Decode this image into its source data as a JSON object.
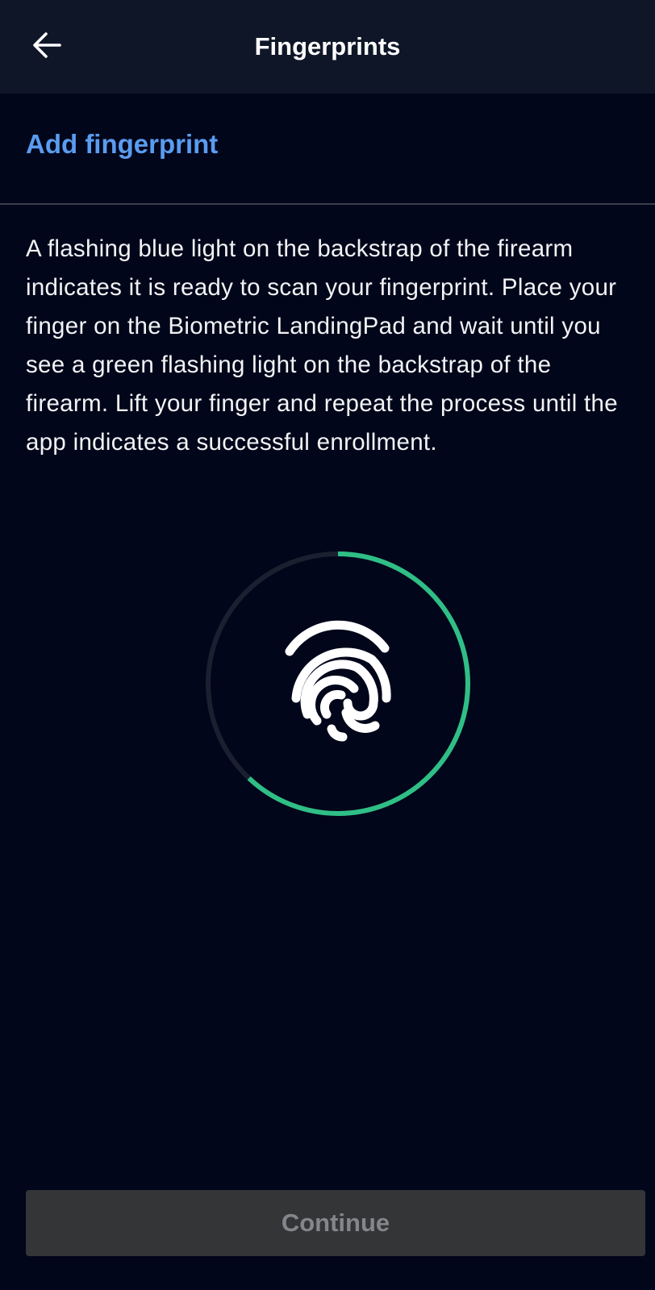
{
  "header": {
    "title": "Fingerprints",
    "back_icon": "arrow-left-icon"
  },
  "section": {
    "title": "Add fingerprint"
  },
  "instructions": {
    "text": "A flashing blue light on the backstrap of the firearm indicates it is ready to scan your fingerprint. Place your finger on the Biometric LandingPad and wait until you see a green flashing light on the backstrap of the firearm. Lift your finger and repeat the process until the app indicates a successful enrollment."
  },
  "enrollment": {
    "progress": 0.62,
    "icon": "fingerprint-icon",
    "progress_color": "#2fbf86",
    "track_color": "#1b2030"
  },
  "footer": {
    "continue_label": "Continue"
  },
  "colors": {
    "background": "#02061a",
    "topbar": "#0f1628",
    "accent": "#5a9cf0",
    "button_disabled_bg": "#343536",
    "button_disabled_text": "#84868c"
  }
}
